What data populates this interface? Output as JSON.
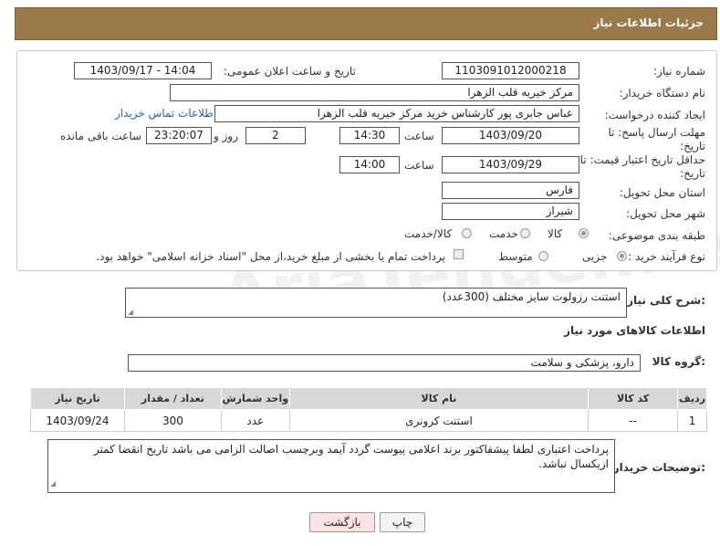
{
  "header": {
    "title": "جزئیات اطلاعات نیاز"
  },
  "form": {
    "need_number": {
      "label": "شماره نیاز:",
      "value": "1103091012000218"
    },
    "announce_datetime": {
      "label": "تاریخ و ساعت اعلان عمومی:",
      "value": "1403/09/17 - 14:04"
    },
    "buyer_org": {
      "label": "نام دستگاه خریدار:",
      "value": "مرکز خیریه قلب الزهرا"
    },
    "creator": {
      "label": "ایجاد کننده درخواست:",
      "value": "عباس جابری پور کارشناس خرید مرکز خیریه قلب الزهرا",
      "contact_link": "اطلاعات تماس خریدار"
    },
    "reply_deadline": {
      "label": "مهلت ارسال پاسخ: تا تاریخ:",
      "date": "1403/09/20",
      "time_label": "ساعت",
      "time": "14:30",
      "days": "2",
      "days_label": "روز و",
      "remaining": "23:20:07",
      "remaining_label": "ساعت باقی مانده"
    },
    "price_validity": {
      "label": "حداقل تاریخ اعتبار قیمت: تا تاریخ:",
      "date": "1403/09/29",
      "time_label": "ساعت",
      "time": "14:00"
    },
    "province": {
      "label": "استان محل تحویل:",
      "value": "فارس"
    },
    "city": {
      "label": "شهر محل تحویل:",
      "value": "شیراز"
    },
    "category": {
      "label": "طبقه بندی موضوعی:",
      "options": [
        "کالا",
        "خدمت",
        "کالا/خدمت"
      ],
      "selected": "کالا"
    },
    "process": {
      "label": "نوع فرآیند خرید :",
      "options": [
        "جزیی",
        "متوسط"
      ],
      "selected": "جزیی",
      "note": "پرداخت تمام یا بخشی از مبلغ خرید،از محل \"اسناد خزانه اسلامی\" خواهد بود."
    }
  },
  "description": {
    "label": "شرح کلی نیاز:",
    "value": "استنت رزولوت سایز مختلف   (300عدد)"
  },
  "goods_info": {
    "title": "اطلاعات کالاهای مورد نیاز"
  },
  "goods_group": {
    "label": "گروه کالا:",
    "value": "دارو، پزشکی و سلامت"
  },
  "table": {
    "headers": [
      "ردیف",
      "کد کالا",
      "نام کالا",
      "واحد شمارش",
      "تعداد / مقدار",
      "تاریخ نیاز"
    ],
    "rows": [
      [
        "1",
        "--",
        "استنت کرونری",
        "عدد",
        "300",
        "1403/09/24"
      ]
    ]
  },
  "buyer_notes": {
    "label": "توضیحات خریدار:",
    "value": "پرداخت اعتباری لطفا پیشفاکتور برند اعلامی پیوست گردد آیمد وبرچسب اصالت الزامی می باشد تاریخ انقضا کمتر ازیکسال نباشد."
  },
  "buttons": {
    "back": "بازگشت",
    "print": "چاپ"
  },
  "watermark": "AriaTender.neT"
}
